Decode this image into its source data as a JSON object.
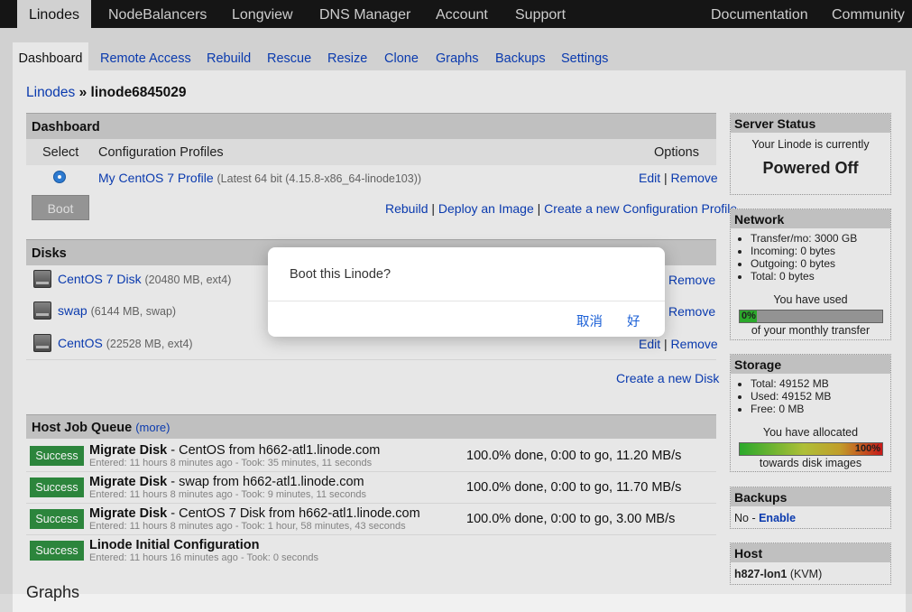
{
  "topnav": {
    "tabs": [
      "Linodes",
      "NodeBalancers",
      "Longview",
      "DNS Manager",
      "Account",
      "Support"
    ],
    "right": [
      "Documentation",
      "Community"
    ]
  },
  "subnav": [
    "Dashboard",
    "Remote Access",
    "Rebuild",
    "Rescue",
    "Resize",
    "Clone",
    "Graphs",
    "Backups",
    "Settings"
  ],
  "breadcrumb": {
    "root": "Linodes",
    "sep": "»",
    "current": "linode6845029"
  },
  "dashboard": {
    "title": "Dashboard",
    "col_select": "Select",
    "col_profiles": "Configuration Profiles",
    "col_options": "Options",
    "profile_name": "My CentOS 7 Profile",
    "profile_detail": "(Latest 64 bit (4.15.8-x86_64-linode103))",
    "edit": "Edit",
    "pipe": "|",
    "remove": "Remove",
    "boot": "Boot",
    "rebuild": "Rebuild",
    "deploy": "Deploy an Image",
    "create_profile": "Create a new Configuration Profile"
  },
  "disks": {
    "title": "Disks",
    "items": [
      {
        "name": "CentOS 7 Disk",
        "detail": "(20480 MB, ext4)",
        "edit": "",
        "remove": "Remove"
      },
      {
        "name": "swap",
        "detail": "(6144 MB, swap)",
        "edit": "",
        "remove": "Remove"
      },
      {
        "name": "CentOS",
        "detail": "(22528 MB, ext4)",
        "edit": "Edit",
        "remove": "Remove"
      }
    ],
    "create": "Create a new Disk"
  },
  "jobs": {
    "title": "Host Job Queue",
    "more": "(more)",
    "items": [
      {
        "status": "Success",
        "title": "Migrate Disk",
        "desc": " - CentOS from h662-atl1.linode.com",
        "meta": "Entered: 11 hours 8 minutes ago - Took: 35 minutes, 11 seconds",
        "progress": "100.0% done, 0:00 to go, 11.20 MB/s"
      },
      {
        "status": "Success",
        "title": "Migrate Disk",
        "desc": " - swap from h662-atl1.linode.com",
        "meta": "Entered: 11 hours 8 minutes ago - Took: 9 minutes, 11 seconds",
        "progress": "100.0% done, 0:00 to go, 11.70 MB/s"
      },
      {
        "status": "Success",
        "title": "Migrate Disk",
        "desc": " - CentOS 7 Disk from h662-atl1.linode.com",
        "meta": "Entered: 11 hours 8 minutes ago - Took: 1 hour, 58 minutes, 43 seconds",
        "progress": "100.0% done, 0:00 to go, 3.00 MB/s"
      },
      {
        "status": "Success",
        "title": "Linode Initial Configuration",
        "desc": "",
        "meta": "Entered: 11 hours 16 minutes ago - Took: 0 seconds",
        "progress": ""
      }
    ]
  },
  "graphs_heading": "Graphs",
  "server_status": {
    "title": "Server Status",
    "line": "Your Linode is currently",
    "state": "Powered Off"
  },
  "network": {
    "title": "Network",
    "items": [
      "Transfer/mo: 3000 GB",
      "Incoming: 0 bytes",
      "Outgoing: 0 bytes",
      "Total: 0 bytes"
    ],
    "used_label": "You have used",
    "used_pct": "0%",
    "used_fraction": 0.0,
    "after": "of your monthly transfer"
  },
  "storage": {
    "title": "Storage",
    "items": [
      "Total: 49152 MB",
      "Used: 49152 MB",
      "Free: 0 MB"
    ],
    "alloc_label": "You have allocated",
    "alloc_pct": "100%",
    "alloc_fraction": 1.0,
    "after": "towards disk images"
  },
  "backups": {
    "title": "Backups",
    "text": "No - ",
    "enable": "Enable"
  },
  "host": {
    "title": "Host",
    "name": "h827-lon1",
    "kind": "(KVM)"
  },
  "dialog": {
    "message": "Boot this Linode?",
    "cancel": "取消",
    "ok": "好"
  },
  "colors": {
    "link": "#0b3db6",
    "success": "#2e8b3f",
    "dialog_button": "#1a5fd6"
  }
}
